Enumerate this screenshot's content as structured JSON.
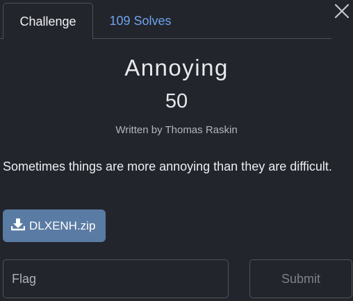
{
  "tabs": [
    {
      "label": "Challenge",
      "active": true
    },
    {
      "label": "109 Solves",
      "active": false
    }
  ],
  "close_icon": "close-icon",
  "challenge": {
    "title": "Annoying",
    "points": "50",
    "author": "Written by Thomas Raskin",
    "description": "Sometimes things are more annoying than they are difficult."
  },
  "file": {
    "name": "DLXENH.zip",
    "icon": "download-icon"
  },
  "flag_form": {
    "placeholder": "Flag",
    "value": "",
    "submit_label": "Submit"
  },
  "colors": {
    "background": "#22252b",
    "tab_link": "#6ea3ef",
    "file_button": "#5a7ba3",
    "border": "#4c515a"
  }
}
